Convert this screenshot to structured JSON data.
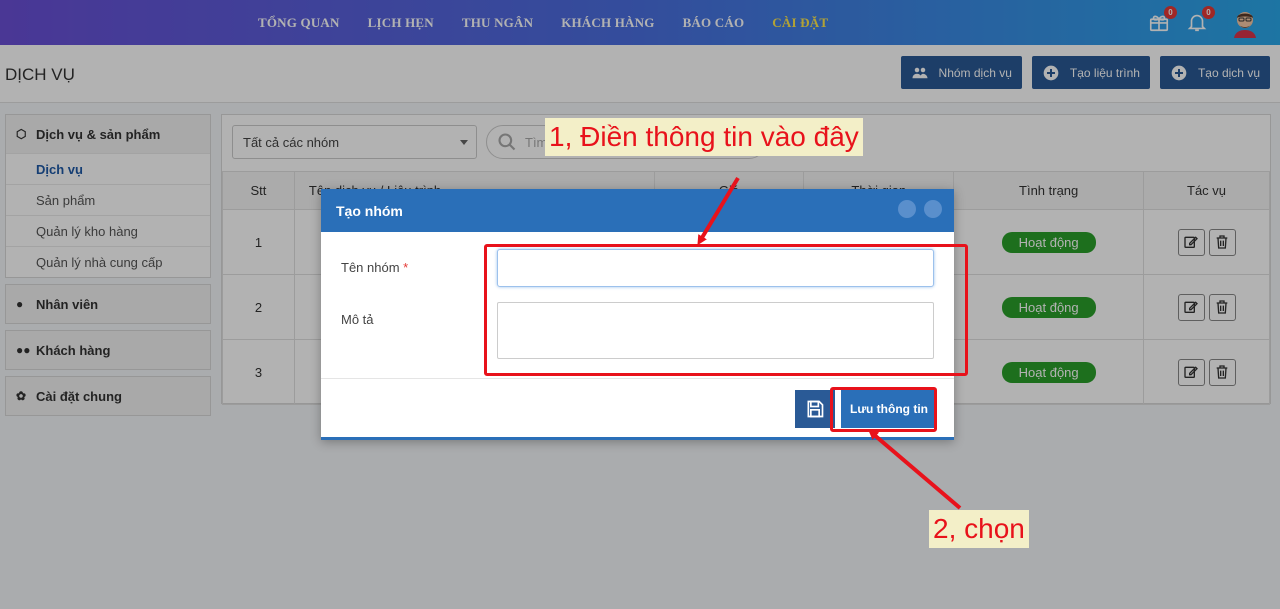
{
  "nav": {
    "items": [
      "TỔNG QUAN",
      "LỊCH HẸN",
      "THU NGÂN",
      "KHÁCH HÀNG",
      "BÁO CÁO",
      "CÀI ĐẶT"
    ],
    "active_index": 5,
    "cart_count": "0",
    "notif_count": "0"
  },
  "header": {
    "title": "DỊCH VỤ",
    "btn_group": "Nhóm dịch vụ",
    "btn_course": "Tạo liệu trình",
    "btn_service": "Tạo dịch vụ"
  },
  "sidebar": {
    "g1_title": "Dịch vụ & sản phẩm",
    "g1_items": [
      "Dịch vụ",
      "Sản phẩm",
      "Quản lý kho hàng",
      "Quản lý nhà cung cấp"
    ],
    "g2_title": "Nhân viên",
    "g3_title": "Khách hàng",
    "g4_title": "Cài đặt chung"
  },
  "content": {
    "filter_value": "Tất cả các nhóm",
    "search_placeholder": "Tìm",
    "columns": [
      "Stt",
      "Tên dịch vụ / Liệu trình",
      "Giá",
      "Thời gian",
      "Tình trạng",
      "Tác vụ"
    ],
    "rows": [
      {
        "stt": "1",
        "status": "Hoạt động"
      },
      {
        "stt": "2",
        "status": "Hoạt động"
      },
      {
        "stt": "3",
        "status": "Hoạt động"
      }
    ]
  },
  "modal": {
    "title": "Tạo nhóm",
    "name_label": "Tên nhóm",
    "required_mark": "*",
    "desc_label": "Mô tả",
    "name_value": "",
    "save_label": "Lưu thông tin"
  },
  "annotations": {
    "note1": "1, Điền thông tin vào đây",
    "note2": "2, chọn"
  },
  "colors": {
    "accent": "#2a6fb8",
    "status_green": "#2aa02a",
    "annotation_red": "#e8121b"
  }
}
